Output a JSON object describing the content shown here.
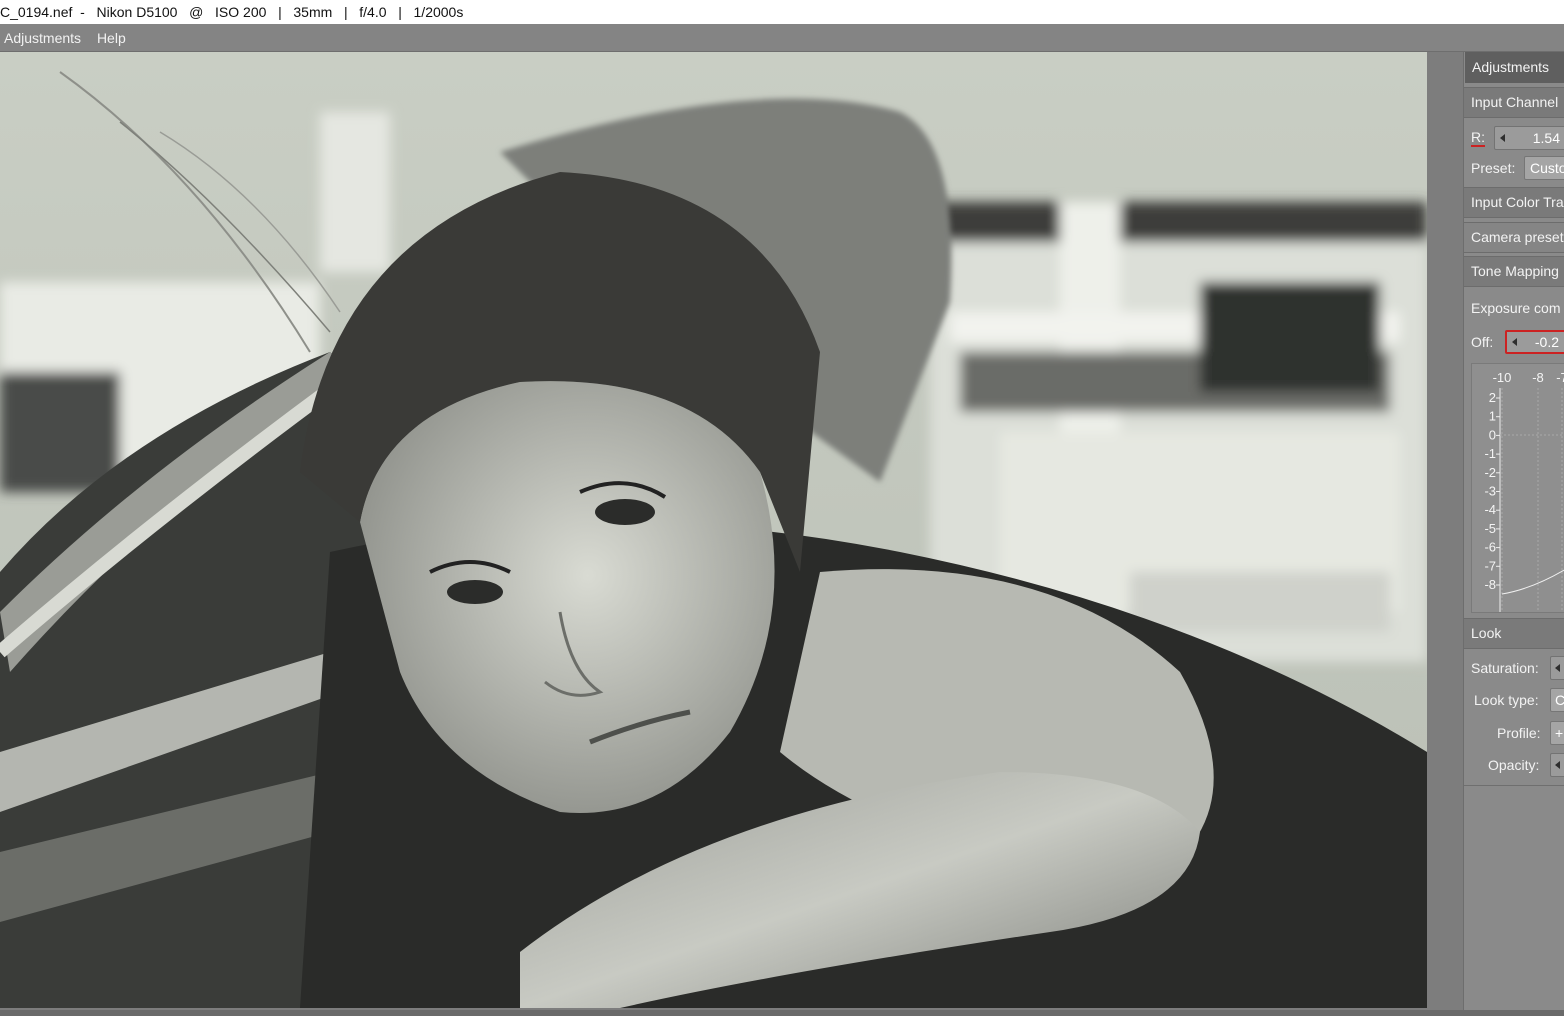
{
  "window": {
    "filename": "C_0194.nef",
    "camera": "Nikon D5100",
    "iso": "ISO 200",
    "focal": "35mm",
    "aperture": "f/4.0",
    "shutter": "1/2000s"
  },
  "menu": {
    "items": [
      "Adjustments",
      "Help"
    ]
  },
  "panel": {
    "tab": "Adjustments",
    "input_channel": {
      "heading": "Input Channel",
      "r_label": "R:",
      "r_value": "1.54",
      "preset_label": "Preset:",
      "preset_value": "Custo"
    },
    "input_color": {
      "heading": "Input Color Tra"
    },
    "camera_preset": {
      "label": "Camera preset"
    },
    "tone_mapping": {
      "heading": "Tone Mapping",
      "exposure_label": "Exposure com",
      "offset_label": "Off:",
      "offset_value": "-0.2",
      "curve_x_ticks": [
        "-10",
        "-8",
        "-7"
      ],
      "curve_y_ticks": [
        "2",
        "1",
        "0",
        "-1",
        "-2",
        "-3",
        "-4",
        "-5",
        "-6",
        "-7",
        "-8"
      ]
    },
    "look": {
      "heading": "Look",
      "saturation_label": "Saturation:",
      "look_type_label": "Look type:",
      "look_type_value": "C",
      "profile_label": "Profile:",
      "profile_value": "+",
      "opacity_label": "Opacity:"
    }
  },
  "colors": {
    "accent_red": "#cc2222",
    "panel_bg": "#8a8a8a",
    "tab_bg": "#5f5f5f"
  }
}
